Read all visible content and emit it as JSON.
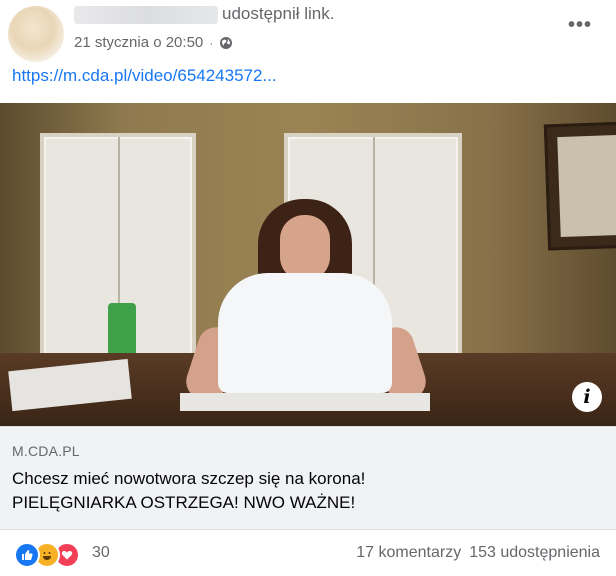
{
  "post": {
    "shared_text": "udostępnił link.",
    "timestamp": "21 stycznia o 20:50",
    "separator": "·",
    "link_text": "https://m.cda.pl/video/654243572...",
    "more_label": "•••"
  },
  "link_preview": {
    "domain": "M.CDA.PL",
    "title_line1": "Chcesz mieć nowotwora szczep się na korona!",
    "title_line2": "PIELĘGNIARKA OSTRZEGA! NWO WAŻNE!",
    "info_glyph": "i"
  },
  "footer": {
    "reaction_count": "30",
    "comments": "17 komentarzy",
    "shares": "153 udostępnienia",
    "reaction_icons": [
      "like-icon",
      "haha-icon",
      "love-icon"
    ]
  },
  "colors": {
    "link": "#1877f2",
    "secondary_text": "#65676b",
    "preview_bg": "#f0f2f5",
    "like": "#1877f2",
    "haha": "#f7b125",
    "love": "#f33e58"
  }
}
